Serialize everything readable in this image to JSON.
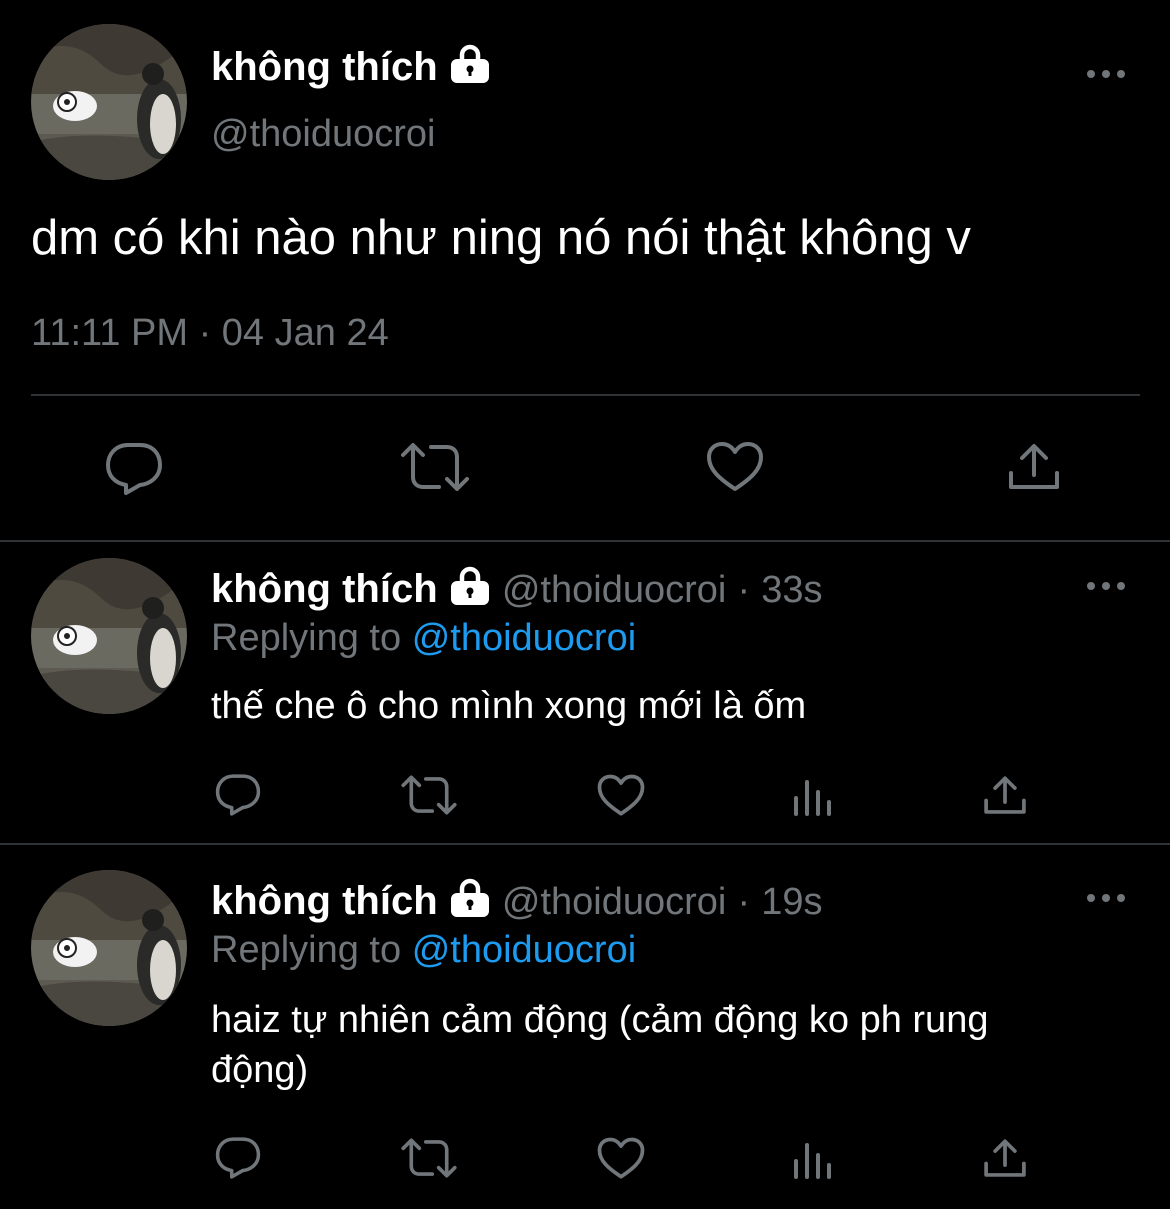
{
  "main_tweet": {
    "display_name": "không thích",
    "handle": "@thoiduocroi",
    "text": "dm có khi nào như ning nó nói thật không v",
    "time": "11:11 PM",
    "separator": "·",
    "date": "04 Jan 24"
  },
  "replies": [
    {
      "display_name": "không thích",
      "handle": "@thoiduocroi",
      "separator": "·",
      "age": "33s",
      "replying_prefix": "Replying to",
      "replying_to": "@thoiduocroi",
      "text": "thế che ô cho mình xong mới là ốm"
    },
    {
      "display_name": "không thích",
      "handle": "@thoiduocroi",
      "separator": "·",
      "age": "19s",
      "replying_prefix": "Replying to",
      "replying_to": "@thoiduocroi",
      "text_line1": "haiz tự nhiên cảm động (cảm động ko ph rung",
      "text_line2": "động)"
    }
  ],
  "icons": [
    "lock-icon",
    "more-icon",
    "reply-icon",
    "retweet-icon",
    "like-icon",
    "share-icon",
    "views-icon"
  ],
  "colors": {
    "background": "#000000",
    "text": "#e7e9ea",
    "muted": "#71767b",
    "link": "#1d9bf0",
    "divider": "#2f3336"
  }
}
